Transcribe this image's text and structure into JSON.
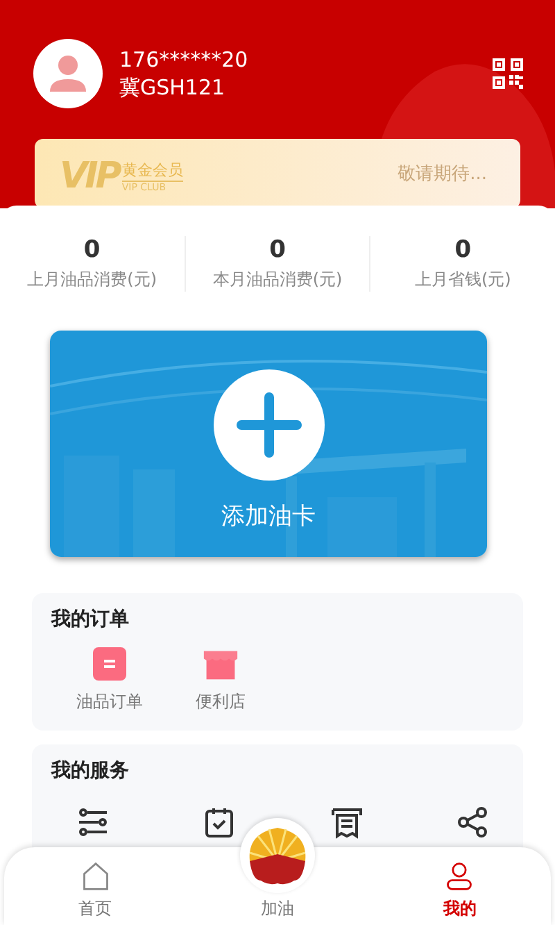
{
  "user": {
    "phone": "176******20",
    "plate": "冀GSH121"
  },
  "vip": {
    "badge": "VIP",
    "title": "黄金会员",
    "sub": "VIP CLUB",
    "status": "敬请期待..."
  },
  "stats": [
    {
      "value": "0",
      "label": "上月油品消费(元)"
    },
    {
      "value": "0",
      "label": "本月油品消费(元)"
    },
    {
      "value": "0",
      "label": "上月省钱(元)"
    }
  ],
  "add_card": {
    "label": "添加油卡"
  },
  "orders": {
    "title": "我的订单",
    "items": [
      {
        "kind": "oil",
        "label": "油品订单"
      },
      {
        "kind": "store",
        "label": "便利店"
      }
    ]
  },
  "services": {
    "title": "我的服务",
    "items": [
      {
        "kind": "sliders"
      },
      {
        "kind": "calendar"
      },
      {
        "kind": "receipt"
      },
      {
        "kind": "share"
      }
    ]
  },
  "nav": [
    {
      "kind": "home",
      "label": "首页",
      "selected": false
    },
    {
      "kind": "fuel",
      "label": "加油",
      "selected": false
    },
    {
      "kind": "me",
      "label": "我的",
      "selected": true
    }
  ]
}
